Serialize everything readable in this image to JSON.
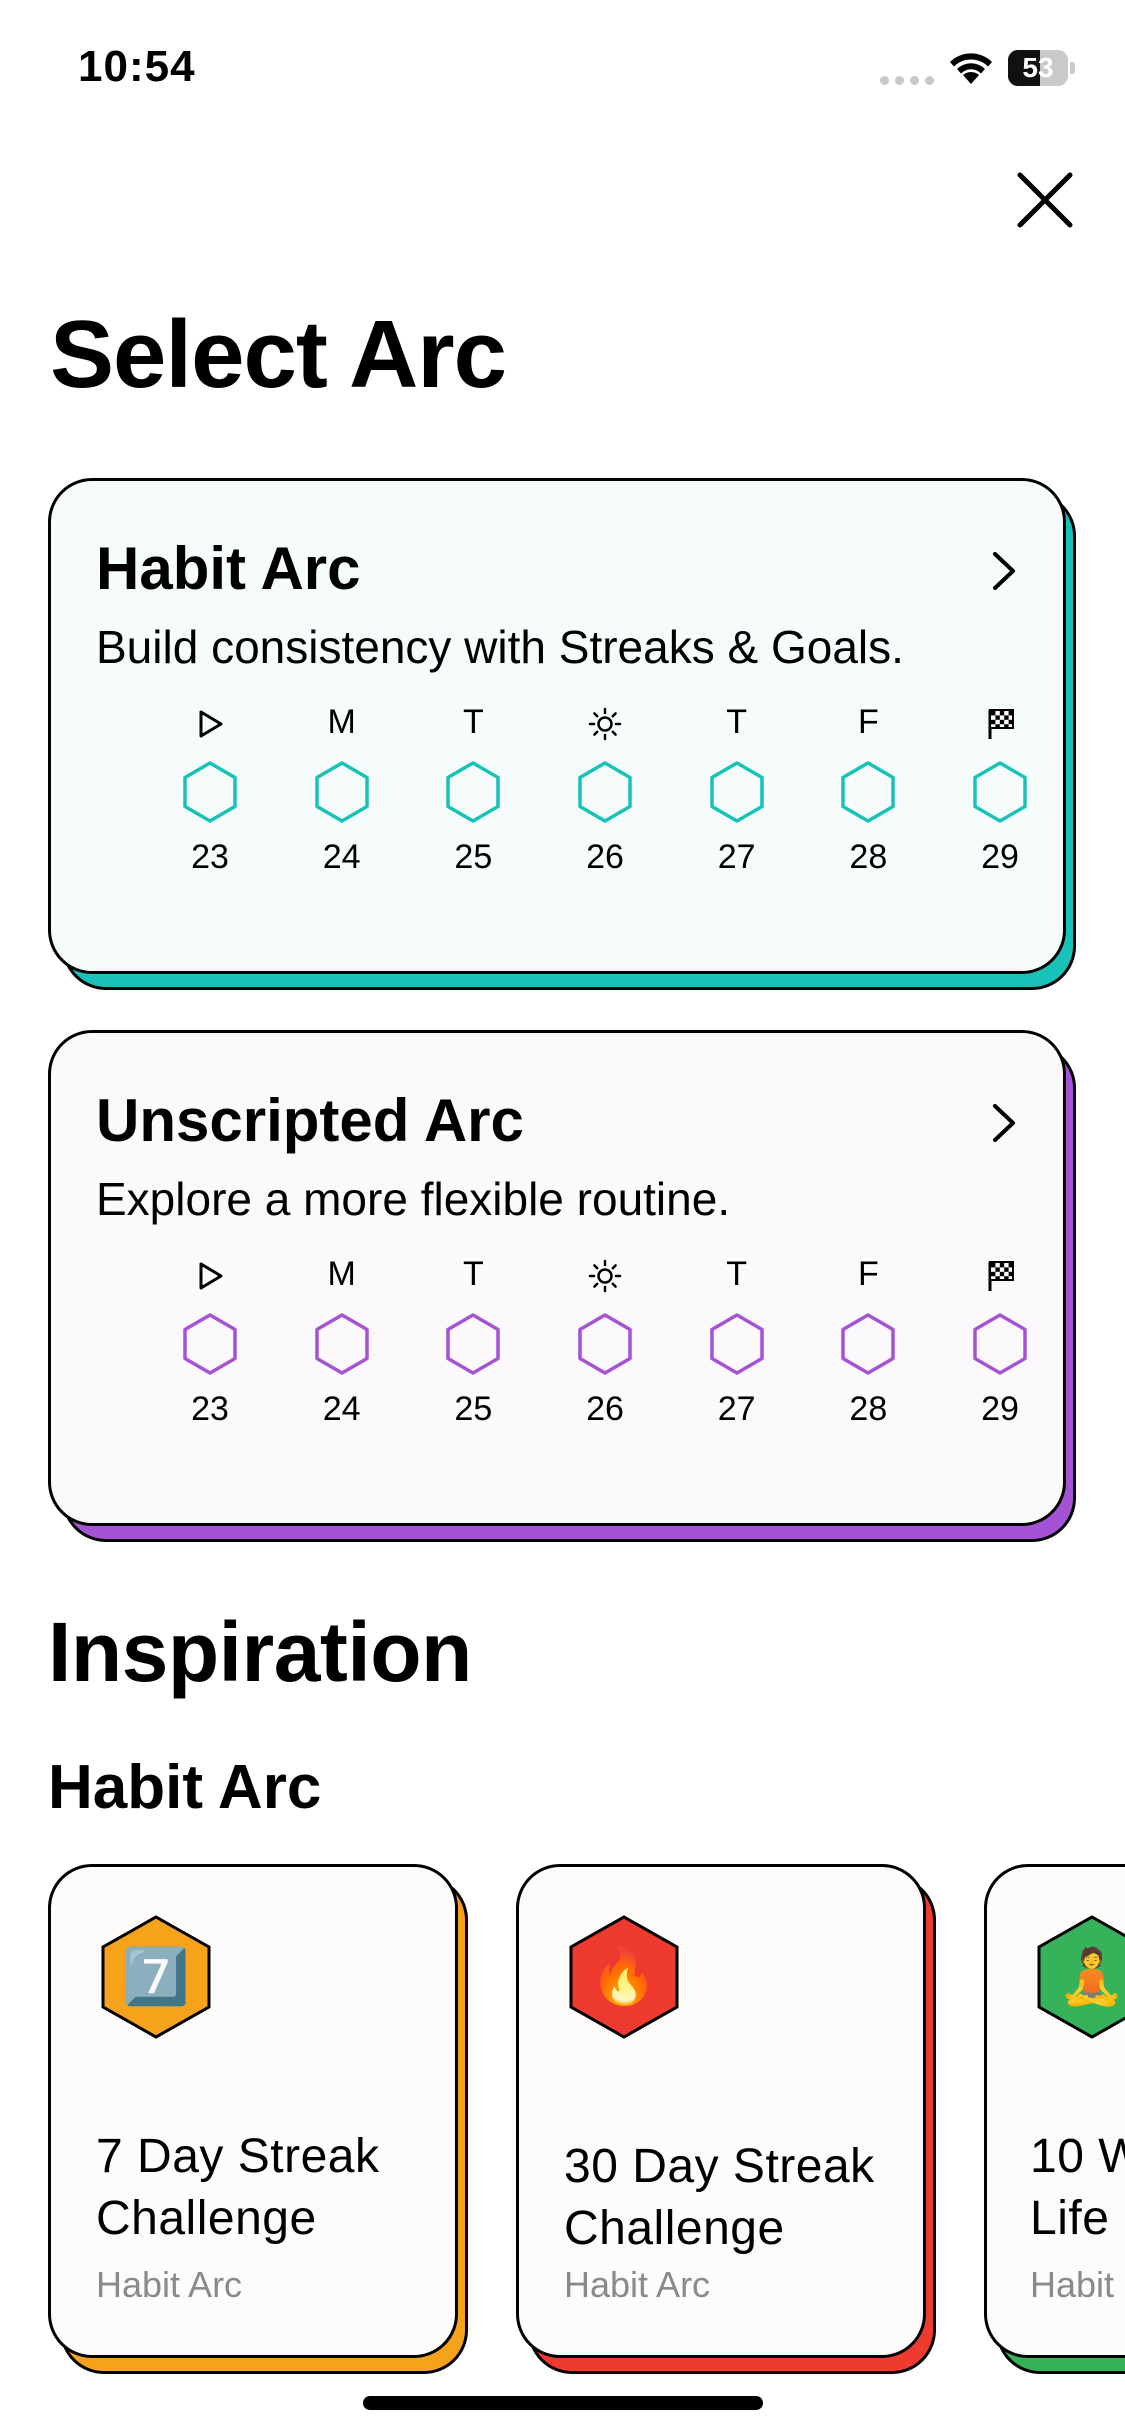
{
  "status_bar": {
    "time": "10:54",
    "battery": "53",
    "battery_level_percent": 53
  },
  "page_title": "Select Arc",
  "arcs": [
    {
      "title": "Habit Arc",
      "description": "Build consistency with Streaks & Goals.",
      "accent": "#19c2b8",
      "face_color": "#f6fcfc",
      "days": [
        {
          "head": "play-icon",
          "date": "23"
        },
        {
          "head": "M",
          "date": "24"
        },
        {
          "head": "T",
          "date": "25"
        },
        {
          "head": "sun-icon",
          "date": "26"
        },
        {
          "head": "T",
          "date": "27"
        },
        {
          "head": "F",
          "date": "28"
        },
        {
          "head": "flag-icon",
          "date": "29"
        }
      ]
    },
    {
      "title": "Unscripted Arc",
      "description": "Explore a more flexible routine.",
      "accent": "#a553d6",
      "face_color": "#fbf9fc",
      "days": [
        {
          "head": "play-icon",
          "date": "23"
        },
        {
          "head": "M",
          "date": "24"
        },
        {
          "head": "T",
          "date": "25"
        },
        {
          "head": "sun-icon",
          "date": "26"
        },
        {
          "head": "T",
          "date": "27"
        },
        {
          "head": "F",
          "date": "28"
        },
        {
          "head": "flag-icon",
          "date": "29"
        }
      ]
    }
  ],
  "inspiration": {
    "title": "Inspiration",
    "subtitle": "Habit Arc",
    "cards": [
      {
        "line1": "7 Day Streak",
        "line2": "Challenge",
        "category": "Habit Arc",
        "icon": "number-seven-icon",
        "emoji": "7️⃣",
        "color": "#f7a21b"
      },
      {
        "line1": "30 Day Streak",
        "line2": "Challenge",
        "category": "Habit Arc",
        "icon": "fire-icon",
        "emoji": "🔥",
        "color": "#ef3a30"
      },
      {
        "line1": "10 W",
        "line2": "Life",
        "category": "Habit",
        "icon": "meditation-icon",
        "emoji": "🧘",
        "color": "#36b35a"
      }
    ]
  }
}
